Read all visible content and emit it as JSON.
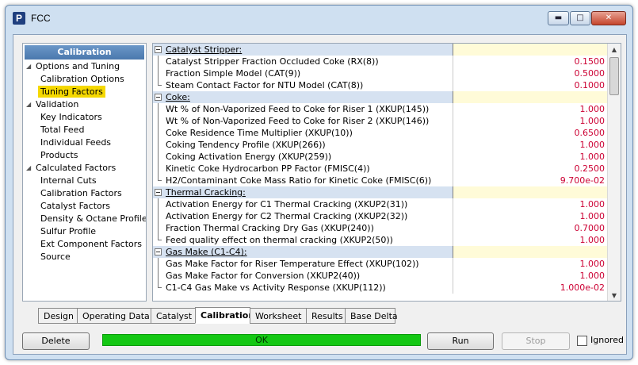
{
  "window": {
    "title": "FCC",
    "app_icon": "P"
  },
  "nav": {
    "header": "Calibration",
    "items": [
      {
        "label": "Options and Tuning",
        "level": 0,
        "expanded": true
      },
      {
        "label": "Calibration Options",
        "level": 1
      },
      {
        "label": "Tuning Factors",
        "level": 1,
        "selected": true
      },
      {
        "label": "Validation",
        "level": 0,
        "expanded": true
      },
      {
        "label": "Key Indicators",
        "level": 1
      },
      {
        "label": "Total Feed",
        "level": 1
      },
      {
        "label": "Individual Feeds",
        "level": 1
      },
      {
        "label": "Products",
        "level": 1
      },
      {
        "label": "Calculated Factors",
        "level": 0,
        "expanded": true
      },
      {
        "label": "Internal Cuts",
        "level": 1
      },
      {
        "label": "Calibration Factors",
        "level": 1
      },
      {
        "label": "Catalyst Factors",
        "level": 1
      },
      {
        "label": "Density & Octane Profiles",
        "level": 1
      },
      {
        "label": "Sulfur Profile",
        "level": 1
      },
      {
        "label": "Ext Component Factors",
        "level": 1
      },
      {
        "label": "Source",
        "level": 1
      }
    ]
  },
  "grid": {
    "sections": [
      {
        "title": "Catalyst Stripper:",
        "rows": [
          {
            "label": "Catalyst Stripper Fraction Occluded Coke (RX(8))",
            "value": "0.1500"
          },
          {
            "label": "Fraction Simple  Model (CAT(9))",
            "value": "0.5000"
          },
          {
            "label": "Steam Contact Factor for NTU Model (CAT(8))",
            "value": "0.1000"
          }
        ]
      },
      {
        "title": "Coke:",
        "rows": [
          {
            "label": "Wt % of Non-Vaporized Feed to Coke for Riser 1 (XKUP(145))",
            "value": "1.000"
          },
          {
            "label": "Wt % of Non-Vaporized Feed to Coke for Riser 2 (XKUP(146))",
            "value": "1.000"
          },
          {
            "label": "Coke Residence Time Multiplier (XKUP(10))",
            "value": "0.6500"
          },
          {
            "label": "Coking Tendency Profile (XKUP(266))",
            "value": "1.000"
          },
          {
            "label": "Coking Activation Energy (XKUP(259))",
            "value": "1.000"
          },
          {
            "label": "Kinetic Coke Hydrocarbon PP Factor (FMISC(4))",
            "value": "0.2500"
          },
          {
            "label": "H2/Contaminant Coke Mass Ratio for Kinetic Coke (FMISC(6))",
            "value": "9.700e-02"
          }
        ]
      },
      {
        "title": "Thermal Cracking:",
        "rows": [
          {
            "label": "Activation Energy for C1 Thermal Cracking (XKUP2(31))",
            "value": "1.000"
          },
          {
            "label": "Activation Energy for C2 Thermal Cracking (XKUP2(32))",
            "value": "1.000"
          },
          {
            "label": "Fraction Thermal Cracking Dry Gas  (XKUP(240))",
            "value": "0.7000"
          },
          {
            "label": "Feed quality effect on thermal cracking (XKUP2(50))",
            "value": "1.000"
          }
        ]
      },
      {
        "title": "Gas Make (C1-C4):",
        "rows": [
          {
            "label": "Gas Make Factor for Riser Temperature Effect (XKUP(102))",
            "value": "1.000"
          },
          {
            "label": "Gas Make Factor for Conversion  (XKUP2(40))",
            "value": "1.000"
          },
          {
            "label": "C1-C4 Gas Make vs Activity Response (XKUP(112))",
            "value": "1.000e-02"
          }
        ]
      }
    ]
  },
  "tabs": [
    "Design",
    "Operating Data",
    "Catalyst",
    "Calibration",
    "Worksheet",
    "Results",
    "Base Delta"
  ],
  "active_tab": "Calibration",
  "buttons": {
    "delete": "Delete",
    "run": "Run",
    "stop": "Stop"
  },
  "status": {
    "text": "OK",
    "color": "#14c814"
  },
  "ignored": {
    "label": "Ignored",
    "checked": false
  },
  "colors": {
    "value_text": "#cc0033",
    "selection": "#f5d800",
    "nav_header": "#5585bb"
  }
}
